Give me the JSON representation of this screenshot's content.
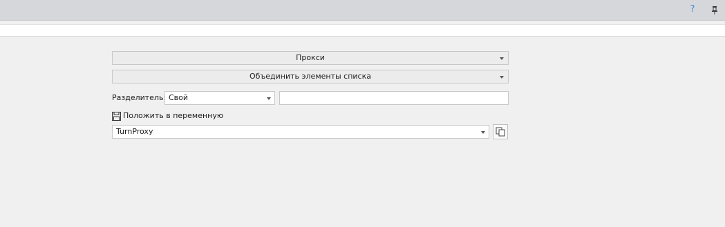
{
  "header": {
    "help_glyph": "?",
    "icons": [
      "help-icon",
      "pin-icon"
    ]
  },
  "form": {
    "proxy_dropdown": {
      "label": "Прокси"
    },
    "action_dropdown": {
      "label": "Объединить элементы списка"
    },
    "separator": {
      "label": "Разделитель:",
      "selected": "Свой",
      "custom_value": ""
    },
    "save_to_variable": {
      "label": "Положить в переменную",
      "icon": "save-icon"
    },
    "variable": {
      "selected": "TurnProxy",
      "copy_icon": "copy-icon"
    }
  },
  "colors": {
    "titlebar": "#d5d7db",
    "background": "#f0f0f0",
    "help_accent": "#4a86d9"
  }
}
